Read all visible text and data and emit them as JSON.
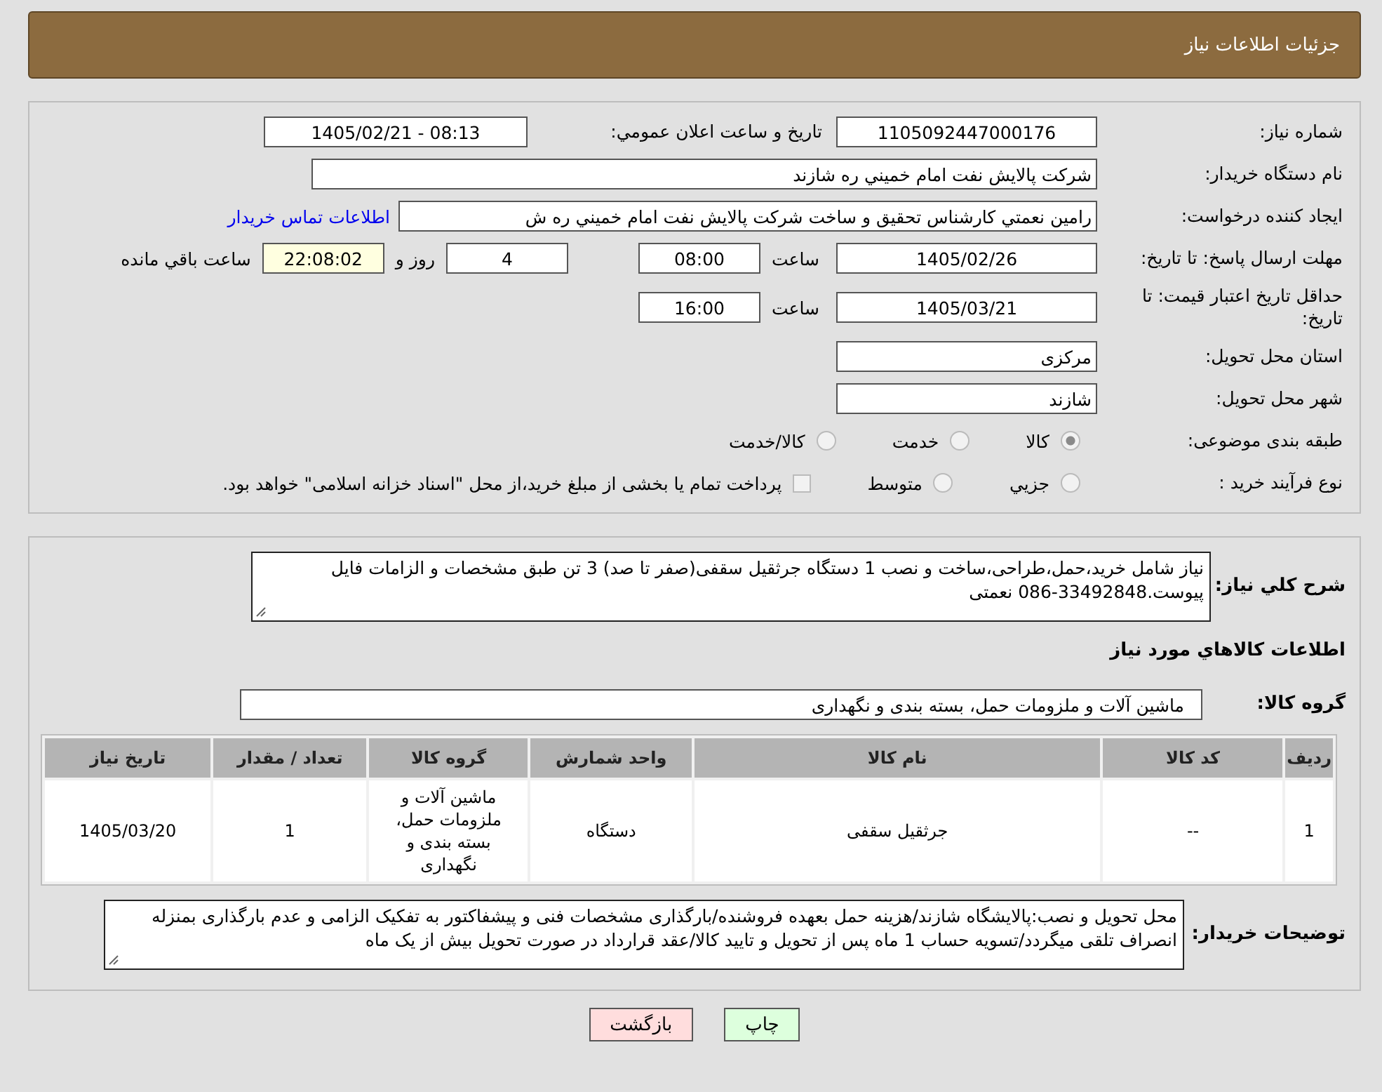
{
  "header": {
    "title": "جزئيات اطلاعات نياز"
  },
  "need_number": {
    "label": "شماره نياز:",
    "value": "1105092447000176"
  },
  "announce": {
    "label": "تاريخ و ساعت اعلان عمومي:",
    "value": "1405/02/21 - 08:13"
  },
  "buyer": {
    "label": "نام دستگاه خريدار:",
    "value": "شرکت پالايش نفت امام خميني  ره  شازند"
  },
  "requester": {
    "label": "ايجاد کننده درخواست:",
    "value": "رامين نعمتي کارشناس تحقيق و ساخت  شرکت پالايش نفت امام خميني  ره  ش",
    "link": "اطلاعات تماس خريدار"
  },
  "deadline": {
    "label": "مهلت ارسال پاسخ: تا تاريخ:",
    "date": "1405/02/26",
    "time_label": "ساعت",
    "time": "08:00",
    "days": "4",
    "days_label": "روز و",
    "remaining": "22:08:02",
    "remaining_label": "ساعت باقي مانده"
  },
  "validity": {
    "label": "حداقل تاريخ اعتبار قيمت: تا تاريخ:",
    "date": "1405/03/21",
    "time_label": "ساعت",
    "time": "16:00"
  },
  "province": {
    "label": "استان محل تحويل:",
    "value": "مرکزی"
  },
  "city": {
    "label": "شهر محل تحويل:",
    "value": "شازند"
  },
  "category": {
    "label": "طبقه بندی موضوعی:",
    "options": [
      {
        "label": "کالا",
        "selected": true
      },
      {
        "label": "خدمت",
        "selected": false
      },
      {
        "label": "کالا/خدمت",
        "selected": false
      }
    ]
  },
  "process": {
    "label": "نوع فرآيند خريد :",
    "options": [
      {
        "label": "جزيي",
        "selected": false
      },
      {
        "label": "متوسط",
        "selected": false
      }
    ],
    "note": {
      "text": "پرداخت تمام يا بخشی از مبلغ خريد،از محل \"اسناد خزانه اسلامی\" خواهد بود.",
      "checked": false
    }
  },
  "description": {
    "label": "شرح كلي نياز:",
    "value": "نياز شامل خريد،حمل،طراحی،ساخت و نصب 1 دستگاه جرثقيل سقفی(صفر تا صد) 3 تن طبق مشخصات و الزامات فايل پيوست.33492848-086 نعمتی"
  },
  "items_heading": "اطلاعات كالاهاي مورد نياز",
  "group": {
    "label": "گروه كالا:",
    "value": "ماشين آلات و ملزومات حمل، بسته بندی و نگهداری"
  },
  "table": {
    "columns": [
      "رديف",
      "کد کالا",
      "نام کالا",
      "واحد شمارش",
      "گروه کالا",
      "تعداد / مقدار",
      "تاريخ نياز"
    ],
    "rows": [
      [
        "1",
        "--",
        "جرثقيل سقفی",
        "دستگاه",
        "ماشين آلات و ملزومات حمل، بسته بندی و نگهداری",
        "1",
        "1405/03/20"
      ]
    ]
  },
  "notes": {
    "label": "توضيحات خريدار:",
    "value": "محل تحويل و نصب:پالايشگاه شازند/هزينه حمل بعهده فروشنده/بارگذاری مشخصات فنی و پيشفاکتور به تفکيک الزامی و عدم بارگذاری بمنزله انصراف تلقی ميگردد/تسويه حساب 1 ماه پس از تحويل و تاييد کالا/عقد قرارداد در صورت تحويل بيش از يک ماه"
  },
  "buttons": [
    {
      "label": "چاپ",
      "kind": "print"
    },
    {
      "label": "بازگشت",
      "kind": "back"
    }
  ]
}
